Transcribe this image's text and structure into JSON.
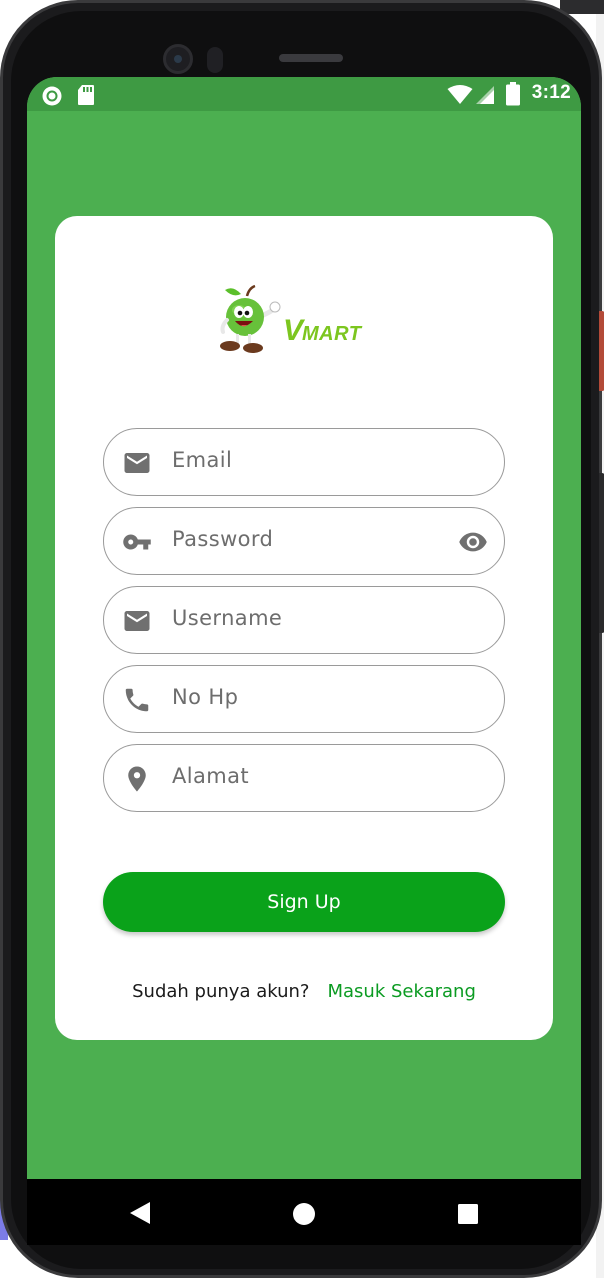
{
  "status_bar": {
    "time": "3:12",
    "left_icons": [
      "notification-circle-icon",
      "sd-card-icon"
    ],
    "right_icons": [
      "wifi-icon",
      "signal-icon",
      "battery-icon"
    ]
  },
  "logo": {
    "mascot": "apple-mascot-icon",
    "brand_v": "V",
    "brand_mart": "MART"
  },
  "form": {
    "fields": [
      {
        "placeholder": "Email",
        "icon": "mail-icon"
      },
      {
        "placeholder": "Password",
        "icon": "key-icon",
        "trailing_icon": "eye-icon"
      },
      {
        "placeholder": "Username",
        "icon": "mail-icon"
      },
      {
        "placeholder": "No Hp",
        "icon": "phone-icon"
      },
      {
        "placeholder": "Alamat",
        "icon": "location-pin-icon"
      }
    ],
    "submit_label": "Sign Up",
    "signin_prompt": "Sudah punya akun?",
    "signin_link": "Masuk Sekarang"
  },
  "nav_bar": {
    "buttons": [
      "back-triangle-icon",
      "home-circle-icon",
      "recents-square-icon"
    ]
  },
  "colors": {
    "background_green": "#4caf50",
    "status_bar_green": "#3e9a43",
    "button_green": "#0aa21a",
    "link_green": "#0b9b22",
    "brand_green": "#7cc61f"
  }
}
